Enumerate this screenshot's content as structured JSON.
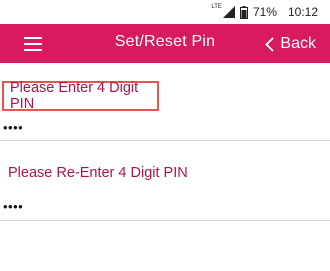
{
  "status_bar": {
    "network": "LTE",
    "battery": "71%",
    "time": "10:12"
  },
  "app_bar": {
    "title": "Set/Reset Pin",
    "back_label": "Back",
    "menu_icon": "hamburger-menu-icon",
    "back_icon": "chevron-left-icon",
    "color": "#d81b60"
  },
  "form": {
    "pin_label": "Please Enter 4 Digit PIN",
    "pin_value": "••••",
    "confirm_label": "Please Re-Enter 4 Digit PIN",
    "confirm_value": "••••",
    "label_color": "#b0124e"
  }
}
